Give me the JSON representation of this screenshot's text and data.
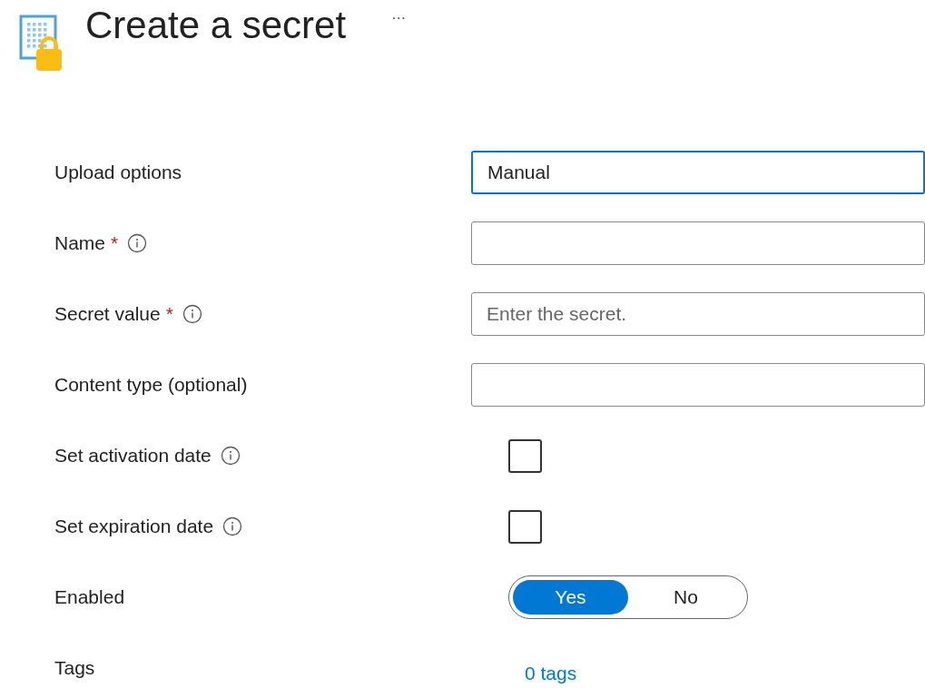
{
  "title": "Create a secret",
  "more": "···",
  "fields": [
    {
      "kind": "select",
      "label": "Upload options",
      "info": false,
      "value": "Manual",
      "focused": true
    },
    {
      "kind": "text",
      "label": "Name",
      "required_mark": "*",
      "info": true,
      "focused": false
    },
    {
      "kind": "text",
      "label": "Secret value",
      "required_mark": "*",
      "info": true,
      "placeholder": "Enter the secret.",
      "focused": false
    },
    {
      "kind": "text",
      "label": "Content type (optional)",
      "info": false,
      "focused": false
    },
    {
      "kind": "checkbox",
      "label": "Set activation date",
      "info": true,
      "checked": false
    },
    {
      "kind": "checkbox",
      "label": "Set expiration date",
      "info": true,
      "checked": false
    },
    {
      "kind": "toggle",
      "label": "Enabled",
      "info": false,
      "options": [
        {
          "label": "Yes",
          "selected": true
        },
        {
          "label": "No",
          "selected": false
        }
      ]
    },
    {
      "kind": "link",
      "label": "Tags",
      "info": false,
      "value": "0 tags"
    }
  ]
}
